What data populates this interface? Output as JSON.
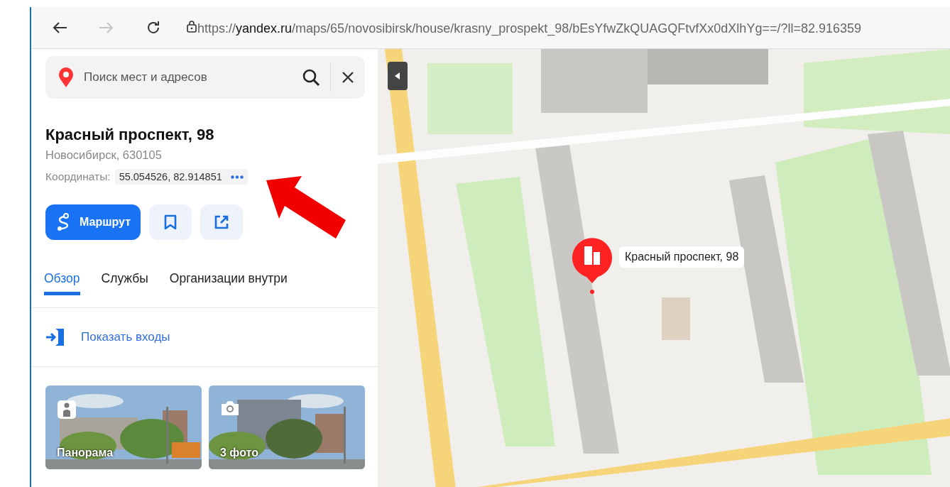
{
  "browser": {
    "nav": [
      {
        "kind": "back",
        "disabled": false
      },
      {
        "kind": "forward",
        "disabled": true
      },
      {
        "kind": "reload",
        "disabled": false
      }
    ],
    "url": "https://**yandex.ru**/maps/65/novosibirsk/house/krasny_prospekt_98/bEsYfwZkQUAGQFtvfXx0dXlhYg==/?ll=82.916359"
  },
  "search": {
    "placeholder": "Поиск мест и адресов"
  },
  "place": {
    "title": "Красный проспект, 98",
    "subtitle": "Новосибирск, 630105",
    "coordinates_label": "Координаты:",
    "coordinates": "55.054526, 82.914851"
  },
  "actions": [
    {
      "kind": "route",
      "label": "Маршрут"
    },
    {
      "kind": "bookmark"
    },
    {
      "kind": "share"
    }
  ],
  "tabs": [
    {
      "label": "Обзор",
      "selected": true
    },
    {
      "label": "Службы",
      "selected": false
    },
    {
      "label": "Организации внутри",
      "selected": false
    }
  ],
  "entrances_link": "Показать входы",
  "media": [
    {
      "kind": "panorama",
      "label": "Панорама"
    },
    {
      "kind": "photos",
      "label": "3 фото"
    }
  ],
  "map": {
    "pin_label": "Красный проспект, 98"
  }
}
